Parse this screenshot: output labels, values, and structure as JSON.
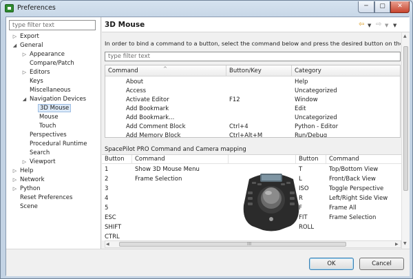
{
  "window": {
    "title": "Preferences",
    "minimize": "─",
    "maximize": "▢",
    "close": "✕"
  },
  "sidebar": {
    "filter_placeholder": "type filter text",
    "tree": [
      {
        "label": "Export",
        "toggle": "▷",
        "level": 0
      },
      {
        "label": "General",
        "toggle": "◢",
        "level": 0
      },
      {
        "label": "Appearance",
        "toggle": "▷",
        "level": 1
      },
      {
        "label": "Compare/Patch",
        "toggle": "",
        "level": 1
      },
      {
        "label": "Editors",
        "toggle": "▷",
        "level": 1
      },
      {
        "label": "Keys",
        "toggle": "",
        "level": 1
      },
      {
        "label": "Miscellaneous",
        "toggle": "",
        "level": 1
      },
      {
        "label": "Navigation Devices",
        "toggle": "◢",
        "level": 1
      },
      {
        "label": "3D Mouse",
        "toggle": "",
        "level": 2,
        "selected": true
      },
      {
        "label": "Mouse",
        "toggle": "",
        "level": 2
      },
      {
        "label": "Touch",
        "toggle": "",
        "level": 2
      },
      {
        "label": "Perspectives",
        "toggle": "",
        "level": 1
      },
      {
        "label": "Procedural Runtime",
        "toggle": "",
        "level": 1
      },
      {
        "label": "Search",
        "toggle": "",
        "level": 1
      },
      {
        "label": "Viewport",
        "toggle": "▷",
        "level": 1
      },
      {
        "label": "Help",
        "toggle": "▷",
        "level": 0
      },
      {
        "label": "Network",
        "toggle": "▷",
        "level": 0
      },
      {
        "label": "Python",
        "toggle": "▷",
        "level": 0
      },
      {
        "label": "Reset Preferences",
        "toggle": "",
        "level": 0
      },
      {
        "label": "Scene",
        "toggle": "",
        "level": 0
      }
    ]
  },
  "page": {
    "title": "3D Mouse",
    "nav": {
      "back": "⇦",
      "back_dropdown": "▼",
      "forward": "⇨",
      "forward_dropdown": "▼",
      "menu": "▼"
    },
    "instructions": "In order to bind a command to a button, select the command below and press the desired button on the navig",
    "filter_placeholder": "type filter text",
    "command_table": {
      "columns": [
        "Command",
        "Button/Key",
        "Category"
      ],
      "sort_indicator": "^",
      "rows": [
        [
          "About",
          "",
          "Help"
        ],
        [
          "Access",
          "",
          "Uncategorized"
        ],
        [
          "Activate Editor",
          "F12",
          "Window"
        ],
        [
          "Add Bookmark",
          "",
          "Edit"
        ],
        [
          "Add Bookmark...",
          "",
          "Uncategorized"
        ],
        [
          "Add Comment Block",
          "Ctrl+4",
          "Python - Editor"
        ],
        [
          "Add Memory Block",
          "Ctrl+Alt+M",
          "Run/Debug"
        ]
      ]
    },
    "mapping": {
      "title": "SpacePilot PRO Command and Camera mapping",
      "columns": [
        "Button",
        "Command",
        "Button",
        "Command"
      ],
      "left": [
        [
          "1",
          "Show 3D Mouse Menu"
        ],
        [
          "2",
          "Frame Selection"
        ],
        [
          "3",
          ""
        ],
        [
          "4",
          ""
        ],
        [
          "5",
          ""
        ],
        [
          "ESC",
          ""
        ],
        [
          "SHIFT",
          ""
        ],
        [
          "CTRL",
          ""
        ]
      ],
      "right": [
        [
          "T",
          "Top/Bottom View"
        ],
        [
          "L",
          "Front/Back View"
        ],
        [
          "ISO",
          "Toggle Perspective"
        ],
        [
          "R",
          "Left/Right Side View"
        ],
        [
          "F",
          "Frame All"
        ],
        [
          "FIT",
          "Frame Selection"
        ],
        [
          "ROLL",
          ""
        ]
      ],
      "hscroll_grip": "III"
    }
  },
  "footer": {
    "ok": "OK",
    "cancel": "Cancel"
  }
}
